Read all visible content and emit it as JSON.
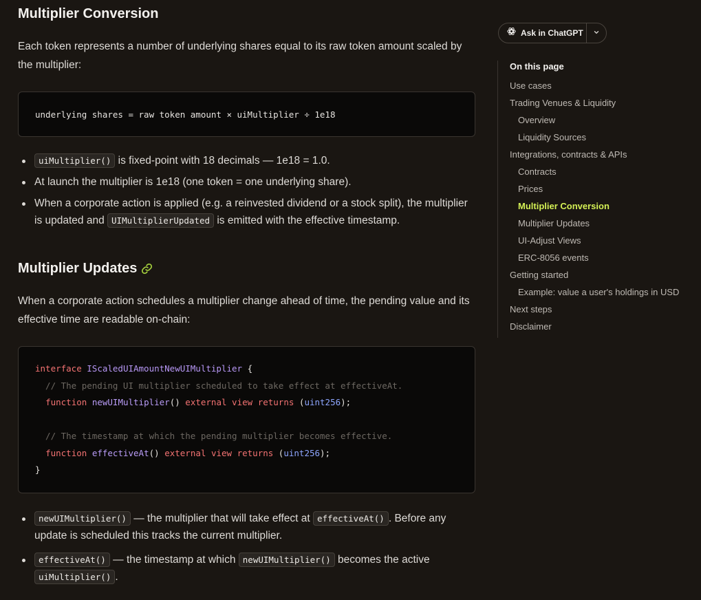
{
  "section1": {
    "title": "Multiplier Conversion",
    "intro": "Each token represents a number of underlying shares equal to its raw token amount scaled by the multiplier:",
    "code": "underlying shares = raw token amount × uiMultiplier ÷ 1e18",
    "bullets": {
      "b1_code": "uiMultiplier()",
      "b1_text": " is fixed-point with 18 decimals — 1e18 = 1.0.",
      "b2_text": "At launch the multiplier is 1e18 (one token = one underlying share).",
      "b3_text": "When a corporate action is applied (e.g. a reinvested dividend or a stock split), the multiplier is updated and ",
      "b3_code": "UIMultiplierUpdated",
      "b3_tail": " is emitted with the effective timestamp."
    }
  },
  "section2": {
    "title": "Multiplier Updates",
    "intro": "When a corporate action schedules a multiplier change ahead of time, the pending value and its effective time are readable on-chain:",
    "code": {
      "l1_kw": "interface",
      "l1_name": "IScaledUIAmountNewUIMultiplier",
      "l1_brace": " {",
      "l2_comment": "  // The pending UI multiplier scheduled to take effect at effectiveAt.",
      "l3_kw": "function",
      "l3_fn": "newUIMultiplier",
      "l3_paren": "()",
      "l3_ext": "external",
      "l3_view": "view",
      "l3_ret": "returns",
      "l3_type": "uint256",
      "l5_comment": "  // The timestamp at which the pending multiplier becomes effective.",
      "l6_kw": "function",
      "l6_fn": "effectiveAt",
      "l6_paren": "()",
      "l6_ext": "external",
      "l6_view": "view",
      "l6_ret": "returns",
      "l6_type": "uint256",
      "l7_brace": "}"
    },
    "bullets": {
      "b1_code": "newUIMultiplier()",
      "b1_text": " — the multiplier that will take effect at ",
      "b1_code2": "effectiveAt()",
      "b1_tail": ". Before any update is scheduled this tracks the current multiplier.",
      "b2_code": "effectiveAt()",
      "b2_text": " — the timestamp at which ",
      "b2_code2": "newUIMultiplier()",
      "b2_text2": " becomes the active ",
      "b2_code3": "uiMultiplier()",
      "b2_tail": "."
    }
  },
  "ask_button": {
    "label": "Ask in ChatGPT"
  },
  "toc": {
    "title": "On this page",
    "items": [
      {
        "label": "Use cases"
      },
      {
        "label": "Trading Venues & Liquidity"
      },
      {
        "label": "Overview"
      },
      {
        "label": "Liquidity Sources"
      },
      {
        "label": "Integrations, contracts & APIs"
      },
      {
        "label": "Contracts"
      },
      {
        "label": "Prices"
      },
      {
        "label": "Multiplier Conversion"
      },
      {
        "label": "Multiplier Updates"
      },
      {
        "label": "UI-Adjust Views"
      },
      {
        "label": "ERC-8056 events"
      },
      {
        "label": "Getting started"
      },
      {
        "label": "Example: value a user's holdings in USD"
      },
      {
        "label": "Next steps"
      },
      {
        "label": "Disclaimer"
      }
    ],
    "active_color": "#d4f055"
  }
}
